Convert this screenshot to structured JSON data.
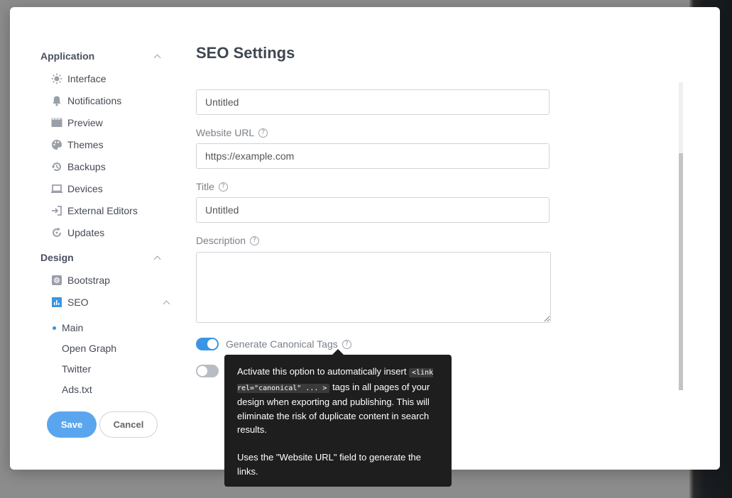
{
  "sidebar": {
    "sections": [
      {
        "label": "Application"
      },
      {
        "label": "Design"
      }
    ],
    "items": [
      {
        "label": "Interface",
        "icon": "sun-icon"
      },
      {
        "label": "Notifications",
        "icon": "bell-icon"
      },
      {
        "label": "Preview",
        "icon": "film-icon"
      },
      {
        "label": "Themes",
        "icon": "palette-icon"
      },
      {
        "label": "Backups",
        "icon": "history-icon"
      },
      {
        "label": "Devices",
        "icon": "laptop-icon"
      },
      {
        "label": "External Editors",
        "icon": "sign-in-icon"
      },
      {
        "label": "Updates",
        "icon": "refresh-icon"
      },
      {
        "label": "Bootstrap",
        "icon": "bootstrap-icon"
      },
      {
        "label": "SEO",
        "icon": "bar-chart-icon"
      }
    ],
    "seo_subitems": [
      {
        "label": "Main",
        "active": true
      },
      {
        "label": "Open Graph"
      },
      {
        "label": "Twitter"
      },
      {
        "label": "Ads.txt"
      }
    ]
  },
  "buttons": {
    "save": "Save",
    "cancel": "Cancel"
  },
  "main": {
    "title": "SEO Settings",
    "fields": {
      "site_name_value": "Untitled",
      "website_url_label": "Website URL",
      "website_url_value": "https://example.com",
      "title_label": "Title",
      "title_value": "Untitled",
      "description_label": "Description",
      "description_value": ""
    },
    "toggles": {
      "canonical_label": "Generate Canonical Tags",
      "canonical_on": true,
      "second_on": false
    },
    "help_glyph": "?"
  },
  "tooltip": {
    "line1_before": "Activate this option to automatically insert",
    "code": "<link rel=\"canonical\" ... >",
    "line1_after": "tags in all pages of your design when exporting and publishing. This will eliminate the risk of duplicate content in search results.",
    "line2": "Uses the \"Website URL\" field to generate the links."
  },
  "colors": {
    "accent": "#3a96e4",
    "save_button": "#5aa6ee",
    "tooltip_bg": "#1e1e1e"
  }
}
